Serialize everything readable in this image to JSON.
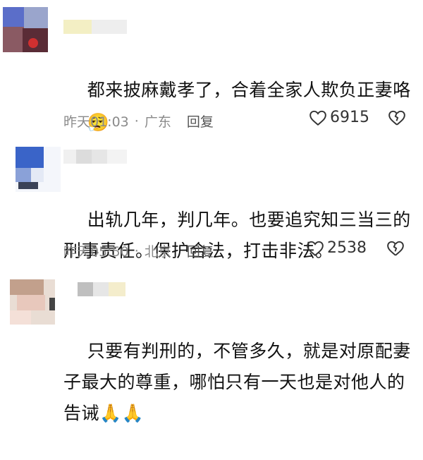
{
  "comments": [
    {
      "text": "都来披麻戴孝了，合着全家人欺负正妻咯",
      "emoji": "😮‍💨",
      "time": "昨天01:03",
      "location": "广东",
      "reply": "回复",
      "likes": "6915"
    },
    {
      "text": "出轨几年，判几年。也要追究知三当三的刑事责任。保护合法，打击非法。",
      "time": "昨天05:50",
      "location": "北京",
      "reply": "回复",
      "likes": "2538"
    },
    {
      "text": "只要有判刑的，不管多久，就是对原配妻子最大的尊重，哪怕只有一天也是对他人的告诫",
      "emoji": "🙏🙏"
    }
  ],
  "meta_separator": "·"
}
